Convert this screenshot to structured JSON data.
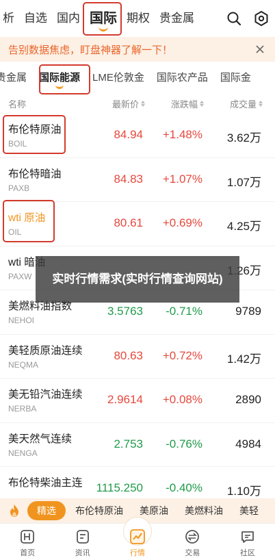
{
  "top_nav": {
    "tabs": [
      "析",
      "自选",
      "国内",
      "国际",
      "期权",
      "贵金属"
    ],
    "active_tab": "国际",
    "search_icon": "search-icon",
    "settings_icon": "gear-icon"
  },
  "banner": {
    "text": "告别数据焦虑，盯盘神器了解一下！",
    "close_icon": "close-icon"
  },
  "sub_tabs": {
    "items": [
      "贵金属",
      "国际能源",
      "LME伦敦金",
      "国际农产品",
      "国际金"
    ],
    "active": "国际能源"
  },
  "table": {
    "headers": {
      "name": "名称",
      "price": "最新价",
      "change": "涨跌幅",
      "volume": "成交量"
    },
    "rows": [
      {
        "name": "布伦特原油",
        "code": "BOIL",
        "price": "84.94",
        "change": "+1.48%",
        "volume": "3.62万",
        "dir": "up"
      },
      {
        "name": "布伦特暗油",
        "code": "PAXB",
        "price": "84.83",
        "change": "+1.07%",
        "volume": "1.07万",
        "dir": "up"
      },
      {
        "name": "wti 原油",
        "code": "OIL",
        "price": "80.61",
        "change": "+0.69%",
        "volume": "4.25万",
        "dir": "up"
      },
      {
        "name": "wti 暗油",
        "code": "PAXW",
        "price": "",
        "change": "",
        "volume": "1.26万",
        "dir": "up"
      },
      {
        "name": "美燃料油指数",
        "code": "NEHOI",
        "price": "3.5763",
        "change": "-0.71%",
        "volume": "9789",
        "dir": "down"
      },
      {
        "name": "美轻质原油连续",
        "code": "NEQMA",
        "price": "80.63",
        "change": "+0.72%",
        "volume": "1.42万",
        "dir": "up"
      },
      {
        "name": "美无铅汽油连续",
        "code": "NERBA",
        "price": "2.9614",
        "change": "+0.08%",
        "volume": "2890",
        "dir": "up"
      },
      {
        "name": "美天然气连续",
        "code": "NENGA",
        "price": "2.753",
        "change": "-0.76%",
        "volume": "4984",
        "dir": "down"
      },
      {
        "name": "布伦特柴油主连",
        "code": "",
        "price": "1115.250",
        "change": "-0.40%",
        "volume": "1.10万",
        "dir": "down"
      }
    ]
  },
  "overlay": {
    "text": "实时行情需求(实时行情查询网站)"
  },
  "quick_bar": {
    "items": [
      "精选",
      "布伦特原油",
      "美原油",
      "美燃料油",
      "美轻"
    ],
    "active": "精选"
  },
  "bottom_nav": {
    "items": [
      {
        "label": "首页",
        "icon": "home-icon"
      },
      {
        "label": "资讯",
        "icon": "news-icon"
      },
      {
        "label": "行情",
        "icon": "chart-icon"
      },
      {
        "label": "交易",
        "icon": "trade-icon"
      },
      {
        "label": "社区",
        "icon": "community-icon"
      }
    ],
    "active": "行情"
  },
  "colors": {
    "up": "#e5483d",
    "down": "#1f9b4a",
    "accent": "#f0941f",
    "highlight_box": "#d33a2c"
  }
}
